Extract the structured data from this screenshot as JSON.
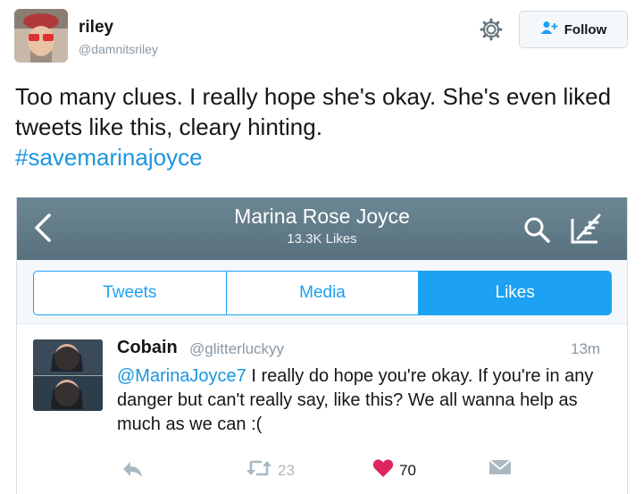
{
  "tweet": {
    "user_name": "riley",
    "user_handle": "@damnitsriley",
    "follow_label": "Follow",
    "text_main": "Too many clues. I really hope she's okay. She's even liked tweets like this, cleary hinting.",
    "hashtag": "#savemarinajoyce"
  },
  "embedded": {
    "profile_name": "Marina Rose Joyce",
    "likes_count": "13.3K Likes",
    "tabs": [
      {
        "label": "Tweets",
        "active": false
      },
      {
        "label": "Media",
        "active": false
      },
      {
        "label": "Likes",
        "active": true
      }
    ],
    "inner_tweet": {
      "name": "Cobain",
      "handle": "@glitterluckyy",
      "time": "13m",
      "mention": "@MarinaJoyce7",
      "text": " I really do hope you're okay. If you're in any danger but can't really say, like this? We all wanna help as much as we can :(",
      "retweets": "23",
      "likes": "70"
    }
  },
  "colors": {
    "link": "#1b95e0",
    "accent": "#1da1f2",
    "nav_bar": "#627c89",
    "like_heart": "#e0245e",
    "muted": "#8899a6"
  },
  "icons": [
    "gear-icon",
    "follow-person-icon",
    "back-chevron-icon",
    "search-icon",
    "compose-icon",
    "reply-icon",
    "retweet-icon",
    "heart-icon",
    "dm-icon"
  ]
}
